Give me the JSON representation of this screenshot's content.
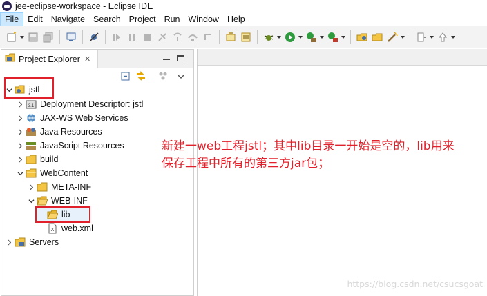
{
  "window": {
    "title": "jee-eclipse-workspace - Eclipse IDE"
  },
  "menu": [
    {
      "label": "File"
    },
    {
      "label": "Edit"
    },
    {
      "label": "Navigate"
    },
    {
      "label": "Search"
    },
    {
      "label": "Project"
    },
    {
      "label": "Run"
    },
    {
      "label": "Window"
    },
    {
      "label": "Help"
    }
  ],
  "project_explorer": {
    "tab_label": "Project Explorer",
    "close_glyph": "✕",
    "tree": [
      {
        "label": "jstl",
        "icon": "project-icon",
        "expanded": true
      },
      {
        "label": "Deployment Descriptor: jstl",
        "icon": "descriptor-icon"
      },
      {
        "label": "JAX-WS Web Services",
        "icon": "webservices-icon"
      },
      {
        "label": "Java Resources",
        "icon": "java-resources-icon"
      },
      {
        "label": "JavaScript Resources",
        "icon": "js-resources-icon"
      },
      {
        "label": "build",
        "icon": "folder-icon"
      },
      {
        "label": "WebContent",
        "icon": "folder-icon",
        "expanded": true
      },
      {
        "label": "META-INF",
        "icon": "folder-icon"
      },
      {
        "label": "WEB-INF",
        "icon": "folder-open-icon",
        "expanded": true
      },
      {
        "label": "lib",
        "icon": "folder-open-icon",
        "selected": true
      },
      {
        "label": "web.xml",
        "icon": "xml-file-icon"
      },
      {
        "label": "Servers",
        "icon": "servers-folder-icon"
      }
    ]
  },
  "annotation": {
    "line1": "新建一web工程jstl；其中lib目录一开始是空的，lib用来",
    "line2": "保存工程中所有的第三方jar包；"
  },
  "watermark": "https://blog.csdn.net/csucsgoat",
  "colors": {
    "annotation": "#e0202a",
    "selection": "#e6f1fb",
    "menu_active": "#cce8ff"
  }
}
